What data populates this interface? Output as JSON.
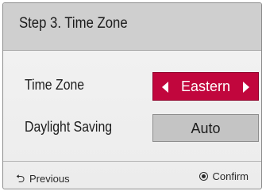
{
  "dialog": {
    "title": "Step 3. Time Zone"
  },
  "time_zone": {
    "label": "Time Zone",
    "value": "Eastern",
    "accent_color": "#c1063d"
  },
  "daylight_saving": {
    "label": "Daylight Saving",
    "value": "Auto"
  },
  "footer": {
    "previous_label": "Previous",
    "previous_icon": "return-arrow-icon",
    "confirm_label": "Confirm",
    "confirm_icon": "ok-circle-icon"
  }
}
